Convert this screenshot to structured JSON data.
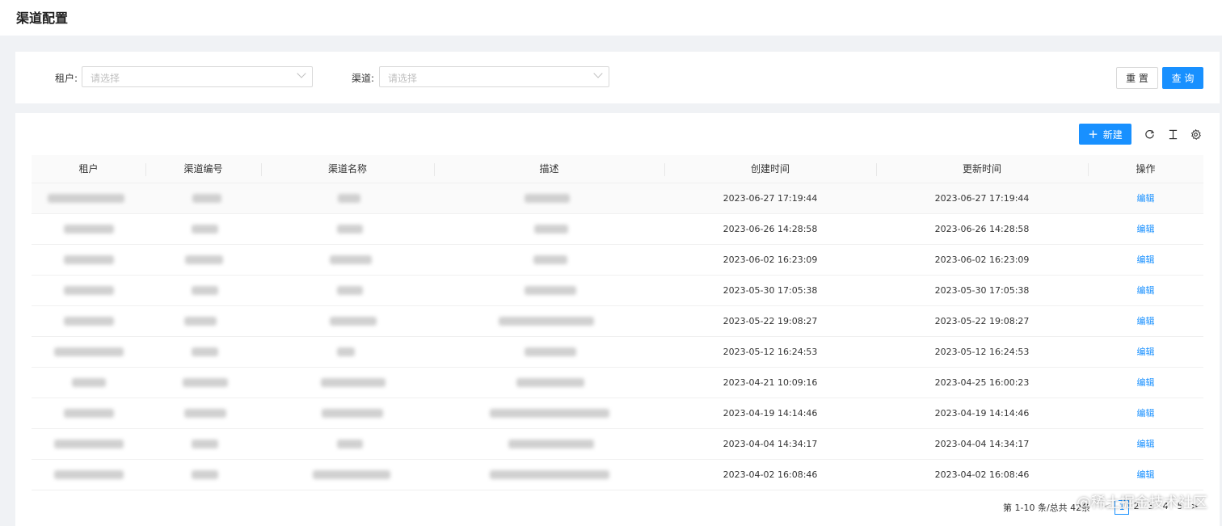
{
  "page": {
    "title": "渠道配置"
  },
  "search": {
    "tenant_label": "租户:",
    "tenant_placeholder": "请选择",
    "channel_label": "渠道:",
    "channel_placeholder": "请选择",
    "reset_label": "重 置",
    "query_label": "查 询"
  },
  "toolbar": {
    "new_label": "新建",
    "new_icon": "plus-icon",
    "icons": [
      "reload-icon",
      "column-height-icon",
      "setting-icon"
    ]
  },
  "table": {
    "columns": [
      "租户",
      "渠道编号",
      "渠道名称",
      "描述",
      "创建时间",
      "更新时间",
      "操作"
    ],
    "rows": [
      {
        "created": "2023-06-27 17:19:44",
        "updated": "2023-06-27 17:19:44",
        "action": "编辑"
      },
      {
        "created": "2023-06-26 14:28:58",
        "updated": "2023-06-26 14:28:58",
        "action": "编辑"
      },
      {
        "created": "2023-06-02 16:23:09",
        "updated": "2023-06-02 16:23:09",
        "action": "编辑"
      },
      {
        "created": "2023-05-30 17:05:38",
        "updated": "2023-05-30 17:05:38",
        "action": "编辑"
      },
      {
        "created": "2023-05-22 19:08:27",
        "updated": "2023-05-22 19:08:27",
        "action": "编辑"
      },
      {
        "created": "2023-05-12 16:24:53",
        "updated": "2023-05-12 16:24:53",
        "action": "编辑"
      },
      {
        "created": "2023-04-21 10:09:16",
        "updated": "2023-04-25 16:00:23",
        "action": "编辑"
      },
      {
        "created": "2023-04-19 14:14:46",
        "updated": "2023-04-19 14:14:46",
        "action": "编辑"
      },
      {
        "created": "2023-04-04 14:34:17",
        "updated": "2023-04-04 14:34:17",
        "action": "编辑"
      },
      {
        "created": "2023-04-02 16:08:46",
        "updated": "2023-04-02 16:08:46",
        "action": "编辑"
      }
    ]
  },
  "pagination": {
    "summary": "第 1-10 条/总共 42条",
    "prev": "<",
    "pages": [
      "1",
      "2",
      "3",
      "4",
      "5"
    ],
    "current": "1",
    "next": ">"
  },
  "watermark": "@稀土掘金技术社区"
}
